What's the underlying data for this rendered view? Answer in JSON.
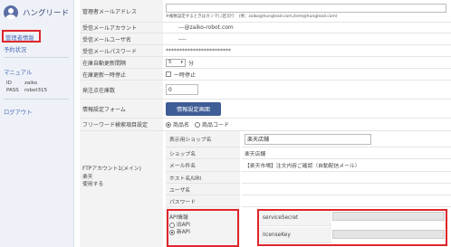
{
  "brand": {
    "name": "ハングリード"
  },
  "sidebar": {
    "active_item": "管理者情報",
    "item_shop": "予約状況",
    "manual": "マニュアル",
    "id_label": "ID",
    "id_value": "zaiko",
    "pass_label": "PASS",
    "pass_value": "robot315",
    "logout": "ログアウト"
  },
  "form": {
    "admin_email": {
      "label": "管理者メールアドレス",
      "note": "※複数設定するときはカンマ(,)区切り　(例：zaiko@hunglead.com,item@hunglead.com)"
    },
    "recv_account": {
      "label": "受信メールアカウント",
      "value": "---@zaiko-robot.com"
    },
    "recv_user": {
      "label": "受信メールユーザ名",
      "value": "----"
    },
    "recv_pass": {
      "label": "受信メールパスワード",
      "value": "************************"
    },
    "stock_interval": {
      "label": "在庫自動更新間隔",
      "value": "5",
      "unit": "分"
    },
    "stock_pause": {
      "label": "在庫更新一時停止",
      "option": "一時停止"
    },
    "order_stock": {
      "label": "発注点在庫数",
      "value": "0"
    },
    "info_form": {
      "label": "情報設定フォーム",
      "button": "情報設定画面"
    },
    "freeword": {
      "label": "フリーワード検索項目設定",
      "opt1": "商品名",
      "opt2": "商品コード"
    }
  },
  "ftp": {
    "label_line1": "FTPアカウント1(メイン)",
    "label_line2": "楽天",
    "label_line3": "使用する",
    "display_shop": {
      "label": "表示用ショップ名",
      "value": "楽天店舗"
    },
    "shop_name": {
      "label": "ショップ名",
      "value": "楽天店舗"
    },
    "mail_subject": {
      "label": "メール件名",
      "value": "【楽天市場】注文内容ご確認（自動配信メール）"
    },
    "host": {
      "label": "ホスト名/URI",
      "value": ""
    },
    "user": {
      "label": "ユーザ名",
      "value": ""
    },
    "password": {
      "label": "パスワード",
      "value": ""
    },
    "api": {
      "title": "API情報",
      "old": "旧API",
      "new": "新API"
    },
    "service_secret": {
      "label": "serviceSecret"
    },
    "license_key": {
      "label": "licenseKey"
    }
  },
  "colors": {
    "accent": "#3f5d96",
    "highlight": "#e0252b"
  }
}
